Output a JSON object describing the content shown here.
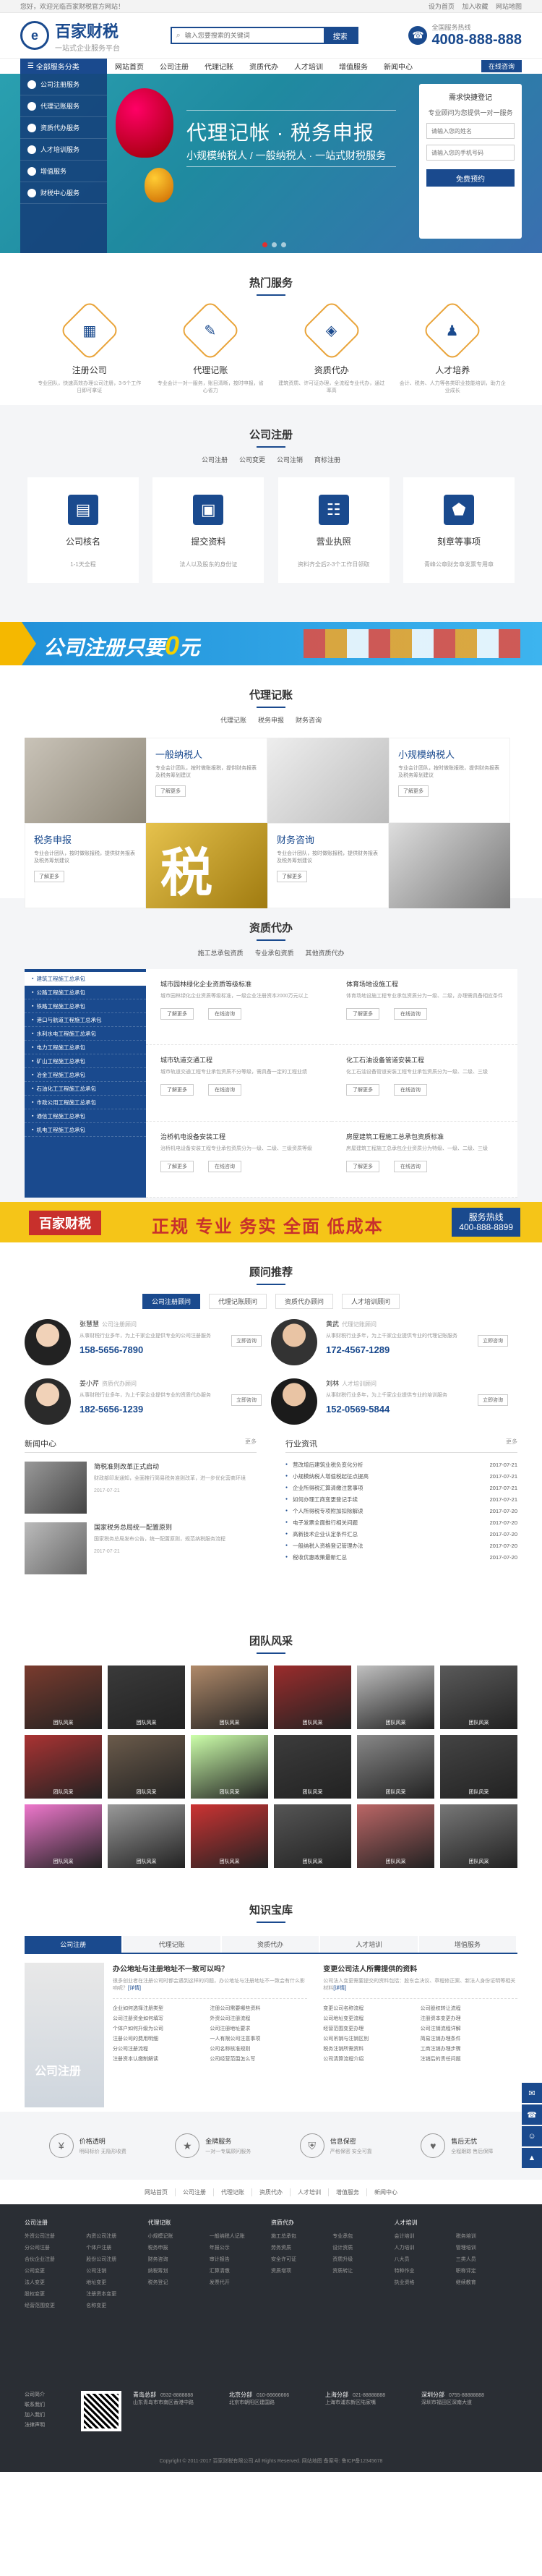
{
  "topbar": {
    "welcome": "您好，欢迎光临百家财税官方网站！",
    "links": [
      "设为首页",
      "加入收藏",
      "网站地图"
    ]
  },
  "header": {
    "logo_title": "百家财税",
    "logo_sub": "一站式企业服务平台",
    "search_placeholder": "输入您要搜索的关键词",
    "search_button": "搜索",
    "hotline_label": "全国服务热线",
    "hotline_number": "4008-888-888"
  },
  "nav": {
    "category": "全部服务分类",
    "items": [
      "网站首页",
      "公司注册",
      "代理记账",
      "资质代办",
      "人才培训",
      "增值服务",
      "新闻中心"
    ],
    "consult": "在线咨询"
  },
  "side_menu": [
    "公司注册服务",
    "代理记账服务",
    "资质代办服务",
    "人才培训服务",
    "增值服务",
    "财税中心服务"
  ],
  "banner": {
    "title": "代理记帐 · 税务申报",
    "subtitle": "小规模纳税人 / 一般纳税人 · 一站式财税服务",
    "form_title": "需求快捷登记",
    "form_sub": "专业顾问为您提供一对一服务",
    "name_placeholder": "请输入您的姓名",
    "phone_placeholder": "请输入您的手机号码",
    "submit": "免费预约"
  },
  "hot_services": {
    "title": "热门服务",
    "items": [
      {
        "name": "注册公司",
        "desc": "专业团队，快速高效办理公司注册，3-5个工作日即可拿证",
        "icon": "building-icon"
      },
      {
        "name": "代理记账",
        "desc": "专业会计一对一服务，账目清晰，按时申报，省心省力",
        "icon": "ledger-icon"
      },
      {
        "name": "资质代办",
        "desc": "建筑资质、许可证办理，全流程专业代办，通过率高",
        "icon": "certificate-icon"
      },
      {
        "name": "人才培养",
        "desc": "会计、税务、人力等各类职业技能培训，助力企业成长",
        "icon": "person-icon"
      }
    ]
  },
  "company_reg": {
    "title": "公司注册",
    "tabs": [
      "公司注册",
      "公司变更",
      "公司注销",
      "商标注册"
    ],
    "cards": [
      {
        "name": "公司核名",
        "desc": "1-1天全程",
        "icon": "document-icon"
      },
      {
        "name": "提交资料",
        "desc": "法人以及股东的身份证",
        "icon": "wallet-icon"
      },
      {
        "name": "营业执照",
        "desc": "资料齐全后2-3个工作日领取",
        "icon": "id-card-icon"
      },
      {
        "name": "刻章等事项",
        "desc": "青峰公章财务章发票专用章",
        "icon": "stamp-icon"
      }
    ]
  },
  "promo1": {
    "text": "公司注册只要",
    "zero": "0",
    "unit": "元"
  },
  "accounting": {
    "title": "代理记账",
    "tabs": [
      "代理记账",
      "税务申报",
      "财务咨询"
    ],
    "cells": [
      {
        "title": "一般纳税人",
        "desc": "专业会计团队，按时做账报税，提供财务报表及税务筹划建议",
        "more": "了解更多"
      },
      {
        "title": "小规模纳税人",
        "desc": "专业会计团队，按时做账报税，提供财务报表及税务筹划建议",
        "more": "了解更多"
      },
      {
        "title": "税务申报",
        "desc": "专业会计团队，按时做账报税，提供财务报表及税务筹划建议",
        "more": "了解更多"
      },
      {
        "title": "财务咨询",
        "desc": "专业会计团队，按时做账报税，提供财务报表及税务筹划建议",
        "more": "了解更多"
      }
    ],
    "tax_char": "税"
  },
  "qualification": {
    "title": "资质代办",
    "tabs": [
      "施工总承包资质",
      "专业承包资质",
      "其他资质代办"
    ],
    "list": [
      "建筑工程施工总承包",
      "公路工程施工总承包",
      "铁路工程施工总承包",
      "港口与航道工程施工总承包",
      "水利水电工程施工总承包",
      "电力工程施工总承包",
      "矿山工程施工总承包",
      "冶金工程施工总承包",
      "石油化工工程施工总承包",
      "市政公用工程施工总承包",
      "通信工程施工总承包",
      "机电工程施工总承包"
    ],
    "items": [
      {
        "title": "城市园林绿化企业资质等级标准",
        "desc": "城市园林绿化企业资质等级标准，一级企业注册资本2000万元以上"
      },
      {
        "title": "体育场地设施工程",
        "desc": "体育场地设施工程专业承包资质分为一级、二级，办理需具备相应条件"
      },
      {
        "title": "城市轨道交通工程",
        "desc": "城市轨道交通工程专业承包资质不分等级，需具备一定的工程业绩"
      },
      {
        "title": "化工石油设备管道安装工程",
        "desc": "化工石油设备管道安装工程专业承包资质分为一级、二级、三级"
      },
      {
        "title": "治桥机电设备安装工程",
        "desc": "治桥机电设备安装工程专业承包资质分为一级、二级、三级资质等级"
      },
      {
        "title": "房屋建筑工程施工总承包资质标准",
        "desc": "房屋建筑工程施工总承包企业资质分为特级、一级、二级、三级"
      }
    ],
    "btn_more": "了解更多",
    "btn_consult": "在线咨询"
  },
  "promo2": {
    "brand": "百家财税",
    "slogan": "正规 专业 务实 全面 低成本",
    "hotline_label": "服务热线",
    "hotline": "400-888-8899"
  },
  "advisors": {
    "title": "顾问推荐",
    "tabs": [
      "公司注册顾问",
      "代理记账顾问",
      "资质代办顾问",
      "人才培训顾问"
    ],
    "people": [
      {
        "name": "张慧慧",
        "role": "公司注册顾问",
        "desc": "从事财税行业多年，为上千家企业提供专业的公司注册服务",
        "tel": "158-5656-7890"
      },
      {
        "name": "黄武",
        "role": "代理记账顾问",
        "desc": "从事财税行业多年，为上千家企业提供专业的代理记账服务",
        "tel": "172-4567-1289"
      },
      {
        "name": "姜小芹",
        "role": "资质代办顾问",
        "desc": "从事财税行业多年，为上千家企业提供专业的资质代办服务",
        "tel": "182-5656-1239"
      },
      {
        "name": "刘林",
        "role": "人才培训顾问",
        "desc": "从事财税行业多年，为上千家企业提供专业的培训服务",
        "tel": "152-0569-5844"
      }
    ],
    "ask": "立即咨询"
  },
  "news": {
    "title": "新闻中心",
    "more": "更多",
    "items": [
      {
        "title": "简税准则改革正式启动",
        "desc": "财政部印发通知，全面推行简易税务准则改革，进一步优化营商环境",
        "date": "2017-07-21"
      },
      {
        "title": "国家税务总局统一配置原则",
        "desc": "国家税务总局发布公告，统一配置原则，规范纳税服务流程",
        "date": "2017-07-21"
      }
    ],
    "industry_title": "行业资讯",
    "industry": [
      {
        "t": "营改增后建筑业税负变化分析",
        "d": "2017-07-21"
      },
      {
        "t": "小规模纳税人增值税起征点提高",
        "d": "2017-07-21"
      },
      {
        "t": "企业所得税汇算清缴注意事项",
        "d": "2017-07-21"
      },
      {
        "t": "如何办理工商变更登记手续",
        "d": "2017-07-21"
      },
      {
        "t": "个人所得税专项附加扣除解读",
        "d": "2017-07-20"
      },
      {
        "t": "电子发票全面推行相关问题",
        "d": "2017-07-20"
      },
      {
        "t": "高新技术企业认定条件汇总",
        "d": "2017-07-20"
      },
      {
        "t": "一般纳税人资格登记管理办法",
        "d": "2017-07-20"
      },
      {
        "t": "税收优惠政策最新汇总",
        "d": "2017-07-20"
      }
    ]
  },
  "team": {
    "title": "团队风采",
    "captions": [
      "团队风采",
      "团队风采",
      "团队风采",
      "团队风采",
      "团队风采",
      "团队风采",
      "团队风采",
      "团队风采",
      "团队风采",
      "团队风采",
      "团队风采",
      "团队风采",
      "团队风采",
      "团队风采",
      "团队风采",
      "团队风采",
      "团队风采",
      "团队风采"
    ]
  },
  "knowledge": {
    "title": "知识宝库",
    "tabs": [
      "公司注册",
      "代理记账",
      "资质代办",
      "人才培训",
      "增值服务"
    ],
    "img_label": "公司注册",
    "left": {
      "headline": "办公地址与注册地址不一致可以吗？",
      "desc": "很多创业者在注册公司时都会遇到这样的问题，办公地址与注册地址不一致会有什么影响呢？",
      "link": "[详情]",
      "list": [
        "企业如何选择注册类型",
        "注册公司需要哪些资料",
        "公司注册资金如何填写",
        "外资公司注册流程",
        "个体户如何升级为公司",
        "公司注册地址要求",
        "注册公司的费用明细",
        "一人有限公司注意事项",
        "分公司注册流程",
        "公司名称核准规则",
        "注册资本认缴制解读",
        "公司经营范围怎么写"
      ]
    },
    "right": {
      "headline": "变更公司法人所需提供的资料",
      "desc": "公司法人变更需要提交的资料包括：股东会决议、章程修正案、新法人身份证明等相关材料",
      "link": "[详情]",
      "list": [
        "变更公司名称流程",
        "公司股权转让流程",
        "公司地址变更流程",
        "注册资本变更办理",
        "经营范围变更办理",
        "公司注销流程详解",
        "公司吊销与注销区别",
        "简易注销办理条件",
        "税务注销所需资料",
        "工商注销办理步骤",
        "公司清算流程介绍",
        "注销后的责任问题"
      ]
    }
  },
  "features": [
    {
      "name": "价格透明",
      "desc": "明码标价 无隐形收费",
      "icon": "price-icon"
    },
    {
      "name": "金牌服务",
      "desc": "一对一专属顾问服务",
      "icon": "medal-icon"
    },
    {
      "name": "信息保密",
      "desc": "严格保密 安全可靠",
      "icon": "shield-icon"
    },
    {
      "name": "售后无忧",
      "desc": "全程跟踪 售后保障",
      "icon": "heart-icon"
    }
  ],
  "footnav": [
    "网站首页",
    "公司注册",
    "代理记账",
    "资质代办",
    "人才培训",
    "增值服务",
    "新闻中心"
  ],
  "footer": {
    "cols": [
      {
        "title": "公司注册",
        "items": [
          "外资公司注册",
          "内资公司注册",
          "分公司注册",
          "个体户注册",
          "合伙企业注册",
          "股份公司注册",
          "公司变更",
          "公司注销",
          "法人变更",
          "地址变更",
          "股权变更",
          "注册资本变更",
          "经营范围变更",
          "名称变更"
        ]
      },
      {
        "title": "代理记账",
        "items": [
          "小规模记账",
          "一般纳税人记账",
          "税务申报",
          "年报公示",
          "财务咨询",
          "审计报告",
          "纳税筹划",
          "汇算清缴",
          "税务登记",
          "发票代开"
        ]
      },
      {
        "title": "资质代办",
        "items": [
          "施工总承包",
          "专业承包",
          "劳务资质",
          "设计资质",
          "安全许可证",
          "资质升级",
          "资质增项",
          "资质转让"
        ]
      },
      {
        "title": "人才培训",
        "items": [
          "会计培训",
          "税务培训",
          "人力培训",
          "管理培训",
          "八大员",
          "三类人员",
          "特种作业",
          "职称评定",
          "执业资格",
          "继续教育"
        ]
      }
    ],
    "side_links": [
      "公司简介",
      "联系我们",
      "加入我们",
      "法律声明"
    ],
    "offices": [
      {
        "city": "青岛总部",
        "tel": "0532-8888888",
        "addr": "山东青岛市市南区香港中路"
      },
      {
        "city": "北京分部",
        "tel": "010-66666666",
        "addr": "北京市朝阳区建国路"
      },
      {
        "city": "上海分部",
        "tel": "021-88888888",
        "addr": "上海市浦东新区陆家嘴"
      },
      {
        "city": "深圳分部",
        "tel": "0755-88888888",
        "addr": "深圳市福田区深南大道"
      }
    ],
    "copyright": "Copyright © 2011-2017 百家财税有限公司 All Rights Reserved.  网站地图  备案号: 鲁ICP备12345678"
  }
}
